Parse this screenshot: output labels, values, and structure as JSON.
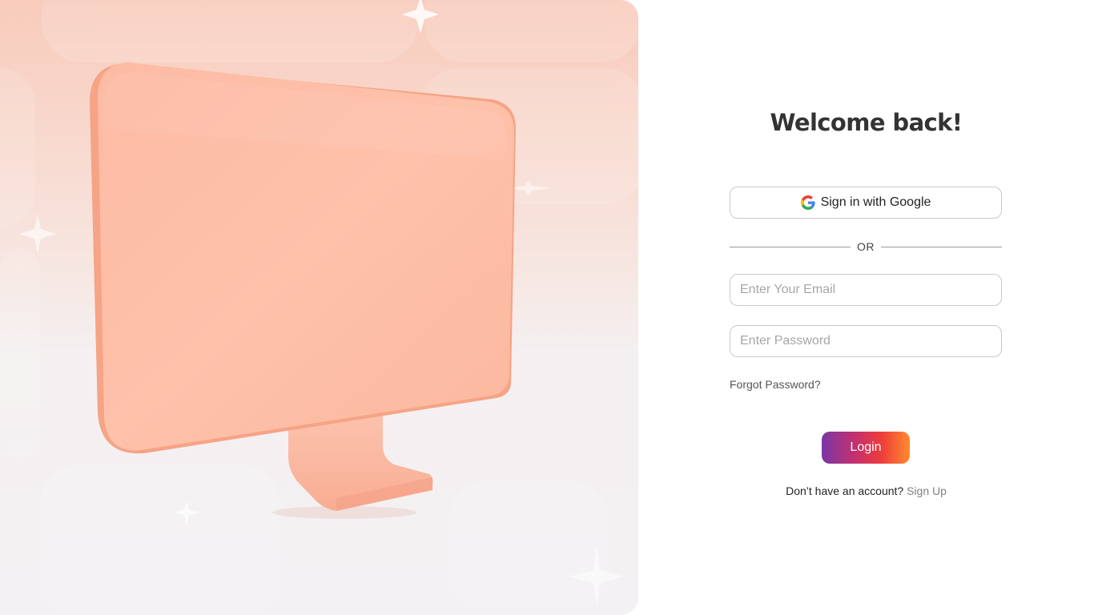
{
  "hero": {
    "illustration": "monitor-3d",
    "colors": {
      "background_top": "#f8cbbb",
      "background_bottom": "#f3f1f3",
      "monitor": "#fcbea6",
      "monitor_edge": "#f6a386"
    }
  },
  "login": {
    "title": "Welcome back!",
    "google_button_label": "Sign in with Google",
    "divider_text": "OR",
    "email_placeholder": "Enter Your Email",
    "email_value": "",
    "password_placeholder": "Enter Password",
    "password_value": "",
    "forgot_password_label": "Forgot Password?",
    "login_button_label": "Login",
    "signup_prompt": "Don’t have an account?",
    "signup_link_label": "Sign Up"
  },
  "colors": {
    "login_gradient": [
      "#7a37a6",
      "#c4306e",
      "#ee3d3b",
      "#ff8a2e"
    ],
    "title": "#333333",
    "field_border": "#c9c9c9"
  }
}
